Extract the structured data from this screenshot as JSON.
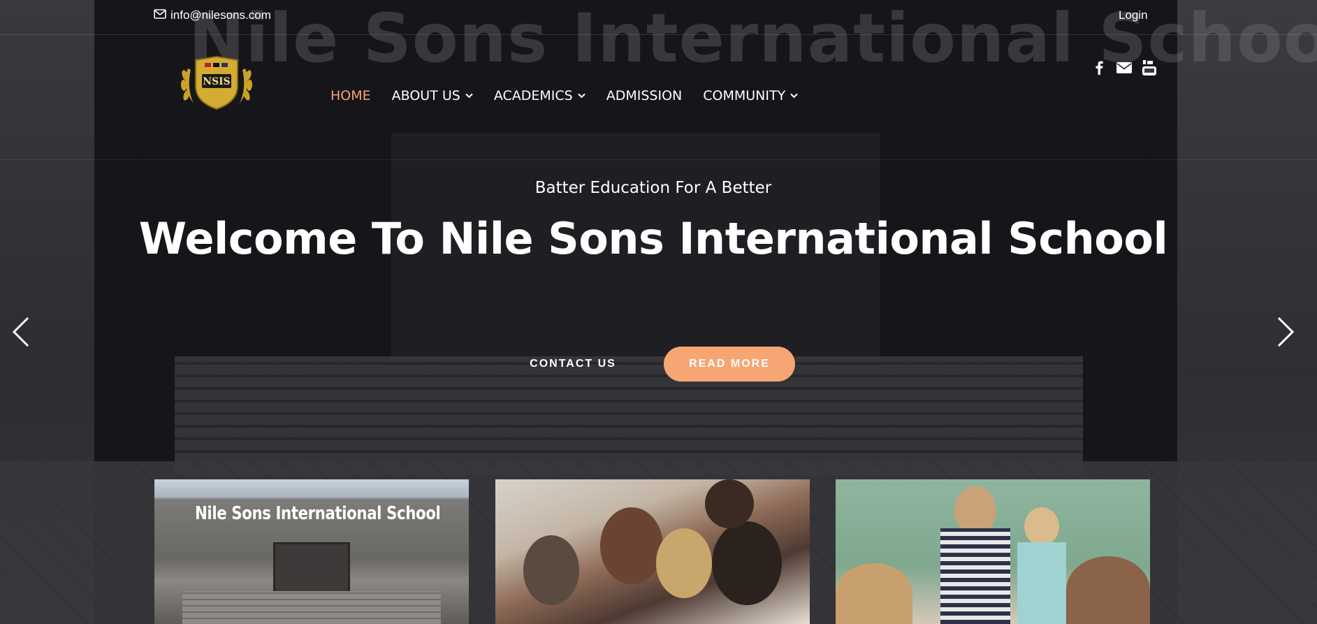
{
  "topbar": {
    "email": "info@nilesons.com",
    "login": "Login"
  },
  "logo": {
    "text": "NSIS"
  },
  "nav": {
    "items": [
      {
        "label": "HOME",
        "active": true,
        "has_dropdown": false
      },
      {
        "label": "ABOUT US",
        "active": false,
        "has_dropdown": true
      },
      {
        "label": "ACADEMICS",
        "active": false,
        "has_dropdown": true
      },
      {
        "label": "ADMISSION",
        "active": false,
        "has_dropdown": false
      },
      {
        "label": "COMMUNITY",
        "active": false,
        "has_dropdown": true
      }
    ]
  },
  "social": {
    "icons": [
      "facebook-icon",
      "envelope-icon",
      "youtube-icon"
    ]
  },
  "hero": {
    "background_wall_text": "Nile Sons International School",
    "tagline": "Batter Education For A Better",
    "headline": "Welcome To Nile Sons International School",
    "contact_button": "CONTACT US",
    "read_more_button": "READ MORE"
  },
  "cards": [
    {
      "photo_sign": "Nile Sons International School"
    },
    {},
    {}
  ],
  "colors": {
    "accent": "#f6a26f",
    "button": "#f6a673"
  }
}
